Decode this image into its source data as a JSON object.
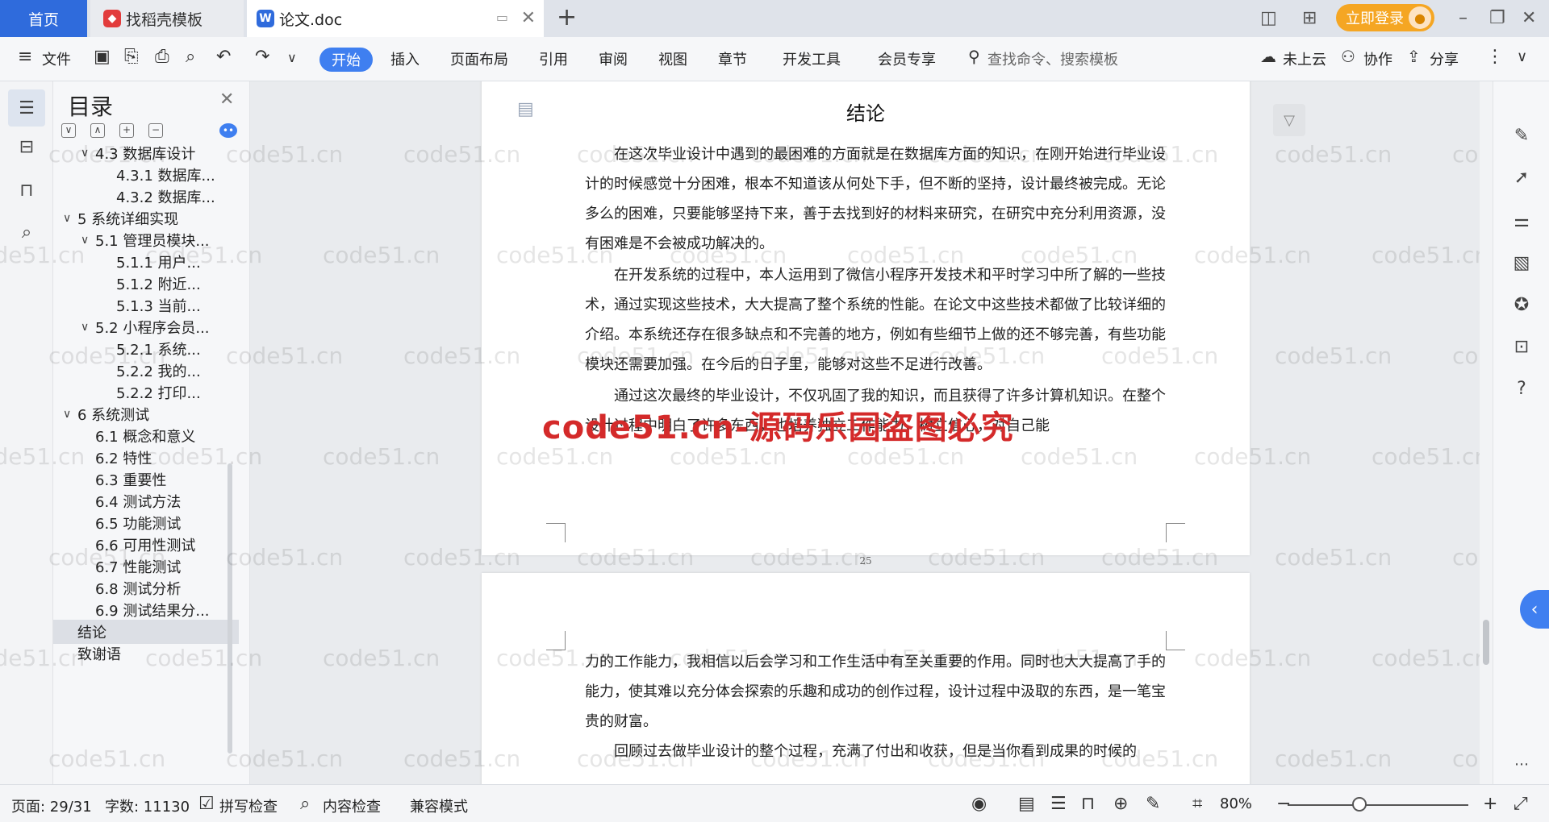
{
  "tabs": {
    "home": "首页",
    "templates": "找稻壳模板",
    "document": "论文.doc"
  },
  "titlebar": {
    "login_label": "立即登录"
  },
  "ribbon": {
    "file": "文件",
    "start": "开始",
    "insert": "插入",
    "page_layout": "页面布局",
    "references": "引用",
    "review": "审阅",
    "view": "视图",
    "chapter": "章节",
    "dev_tools": "开发工具",
    "member": "会员专享",
    "search_placeholder": "查找命令、搜索模板",
    "cloud": "未上云",
    "collaborate": "协作",
    "share": "分享"
  },
  "toc": {
    "title": "目录",
    "items": [
      {
        "label": "4.3 数据库设计",
        "level": 2,
        "arrow": "∨"
      },
      {
        "label": "4.3.1 数据库...",
        "level": 3,
        "arrow": ""
      },
      {
        "label": "4.3.2 数据库...",
        "level": 3,
        "arrow": ""
      },
      {
        "label": "5 系统详细实现",
        "level": 1,
        "arrow": "∨"
      },
      {
        "label": "5.1 管理员模块...",
        "level": 2,
        "arrow": "∨"
      },
      {
        "label": "5.1.1 用户...",
        "level": 3,
        "arrow": ""
      },
      {
        "label": "5.1.2 附近...",
        "level": 3,
        "arrow": ""
      },
      {
        "label": "5.1.3 当前...",
        "level": 3,
        "arrow": ""
      },
      {
        "label": "5.2 小程序会员...",
        "level": 2,
        "arrow": "∨"
      },
      {
        "label": "5.2.1 系统...",
        "level": 3,
        "arrow": ""
      },
      {
        "label": "5.2.2 我的...",
        "level": 3,
        "arrow": ""
      },
      {
        "label": "5.2.2 打印...",
        "level": 3,
        "arrow": ""
      },
      {
        "label": "6 系统测试",
        "level": 1,
        "arrow": "∨"
      },
      {
        "label": "6.1 概念和意义",
        "level": 2,
        "arrow": ""
      },
      {
        "label": "6.2 特性",
        "level": 2,
        "arrow": ""
      },
      {
        "label": "6.3 重要性",
        "level": 2,
        "arrow": ""
      },
      {
        "label": "6.4 测试方法",
        "level": 2,
        "arrow": ""
      },
      {
        "label": "6.5 功能测试",
        "level": 2,
        "arrow": ""
      },
      {
        "label": "6.6 可用性测试",
        "level": 2,
        "arrow": ""
      },
      {
        "label": "6.7 性能测试",
        "level": 2,
        "arrow": ""
      },
      {
        "label": "6.8 测试分析",
        "level": 2,
        "arrow": ""
      },
      {
        "label": "6.9 测试结果分...",
        "level": 2,
        "arrow": ""
      },
      {
        "label": "结论",
        "level": 1,
        "arrow": "",
        "active": true
      },
      {
        "label": "致谢语",
        "level": 1,
        "arrow": ""
      }
    ]
  },
  "document": {
    "heading": "结论",
    "page1_paragraphs": [
      "在这次毕业设计中遇到的最困难的方面就是在数据库方面的知识，在刚开始进行毕业设计的时候感觉十分困难，根本不知道该从何处下手，但不断的坚持，设计最终被完成。无论多么的困难，只要能够坚持下来，善于去找到好的材料来研究，在研究中充分利用资源，没有困难是不会被成功解决的。",
      "在开发系统的过程中，本人运用到了微信小程序开发技术和平时学习中所了解的一些技术，通过实现这些技术，大大提高了整个系统的性能。在论文中这些技术都做了比较详细的介绍。本系统还存在很多缺点和不完善的地方，例如有些细节上做的还不够完善，有些功能模块还需要加强。在今后的日子里，能够对这些不足进行改善。",
      "通过这次最终的毕业设计，不仅巩固了我的知识，而且获得了许多计算机知识。在整个设计过程中明白了许多东西，也培养独立工作能力，树立信心，对自己能"
    ],
    "page_number": "25",
    "page2_paragraphs": [
      "力的工作能力，我相信以后会学习和工作生活中有至关重要的作用。同时也大大提高了手的能力，使其难以充分体会探索的乐趣和成功的创作过程，设计过程中汲取的东西，是一笔宝贵的财富。",
      "回顾过去做毕业设计的整个过程，充满了付出和收获，但是当你看到成果的时候的"
    ],
    "watermark": "code51.cn-源码乐园盗图必究",
    "repeat_watermark": "code51.cn"
  },
  "statusbar": {
    "page": "页面: 29/31",
    "words": "字数: 11130",
    "spell_check": "拼写检查",
    "content_check": "内容检查",
    "compat_mode": "兼容模式",
    "zoom": "80%",
    "zoom_level_percent": 80
  },
  "colors": {
    "accent": "#3f7ff0",
    "home_tab": "#2f6bdc",
    "login": "#f5a623",
    "watermark_red": "#d42a2a"
  }
}
